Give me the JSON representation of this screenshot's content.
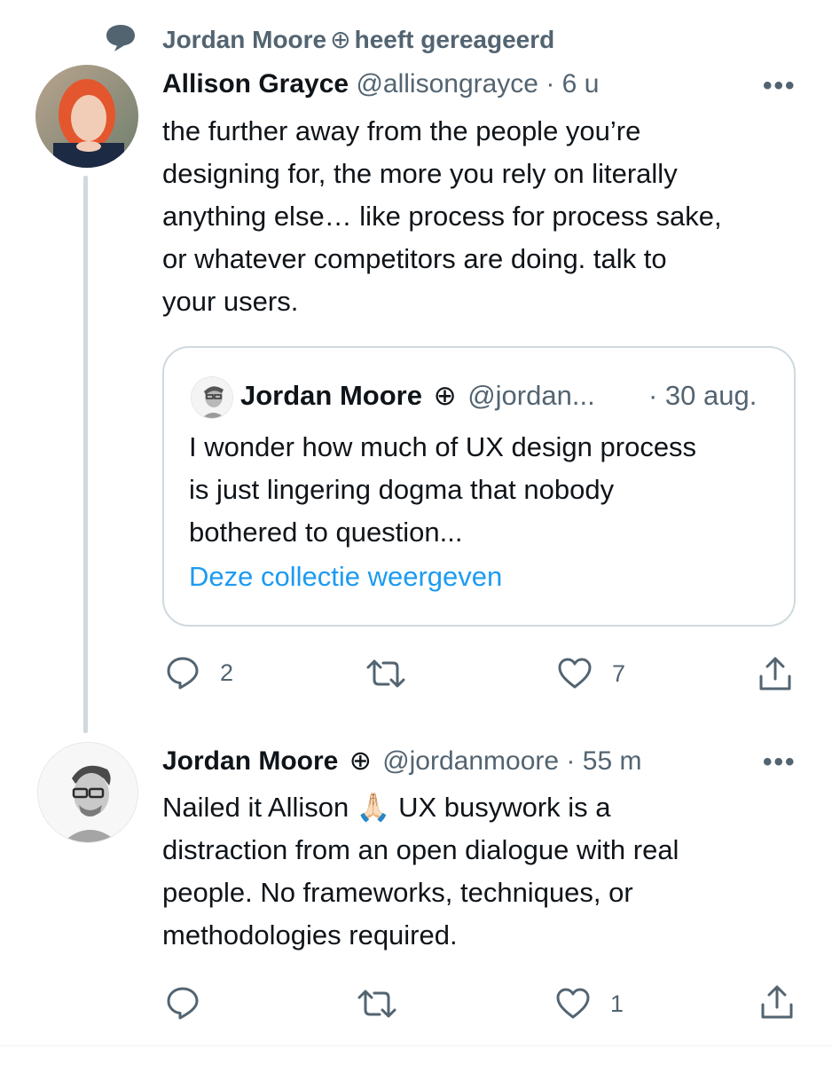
{
  "context": {
    "icon": "speech-bubble-icon",
    "name": "Jordan Moore",
    "badge": "⊕",
    "action": "heeft gereageerd"
  },
  "tweet1": {
    "name": "Allison Grayce",
    "handle": "@allisongrayce",
    "separator": "·",
    "time": "6 u",
    "more": "•••",
    "text": "the further away from the people you’re\ndesigning for, the more you rely on literally\nanything else… like process for process sake,\nor whatever competitors are doing. talk to\nyour users.",
    "quote": {
      "name": "Jordan Moore",
      "badge": "⊕",
      "handle": "@jordan...",
      "time": "· 30 aug.",
      "text": "I wonder how much of UX design process\nis just lingering dogma that nobody\nbothered to question...",
      "link": "Deze collectie weergeven"
    },
    "actions": {
      "reply_count": "2",
      "retweet_count": "",
      "like_count": "7"
    }
  },
  "tweet2": {
    "name": "Jordan Moore",
    "badge": "⊕",
    "handle": "@jordanmoore",
    "separator": "·",
    "time": "55 m",
    "more": "•••",
    "text_before_emoji": "Nailed it Allison ",
    "emoji": "🙏🏻",
    "text_after_emoji": " UX busywork is a\ndistraction from an open dialogue with real\npeople. No frameworks, techniques, or\nmethodologies required.",
    "actions": {
      "reply_count": "",
      "retweet_count": "",
      "like_count": "1"
    }
  },
  "colors": {
    "text": "#0f1419",
    "secondary": "#536471",
    "link": "#1d9bf0",
    "border": "#cfd9de"
  }
}
